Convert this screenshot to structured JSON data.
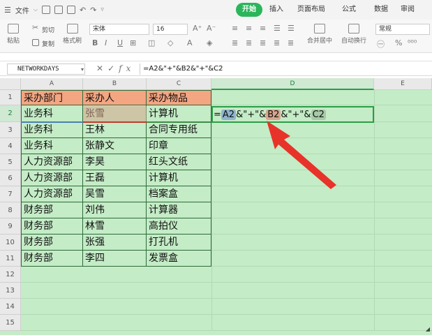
{
  "menu": {
    "file_label": "文件",
    "tabs": [
      {
        "label": "开始",
        "active": true
      },
      {
        "label": "插入",
        "active": false
      },
      {
        "label": "页面布局",
        "active": false
      },
      {
        "label": "公式",
        "active": false
      },
      {
        "label": "数据",
        "active": false
      },
      {
        "label": "审阅",
        "active": false
      }
    ]
  },
  "ribbon": {
    "paste_label": "粘贴",
    "cut_label": "剪切",
    "copy_label": "复制",
    "format_painter_label": "格式刷",
    "font_name": "宋体",
    "font_size": "16",
    "merge_label": "合并居中",
    "wrap_label": "自动换行",
    "number_format": "常规"
  },
  "formula_bar": {
    "name_box": "NETWORKDAYS",
    "formula": "=A2&\"+\"&B2&\"+\"&C2"
  },
  "sheet": {
    "columns": [
      "A",
      "B",
      "C",
      "D",
      "E"
    ],
    "rows": [
      "1",
      "2",
      "3",
      "4",
      "5",
      "6",
      "7",
      "8",
      "9",
      "10",
      "11",
      "12",
      "13",
      "14",
      "15"
    ],
    "headers": [
      "采办部门",
      "采办人",
      "采办物品"
    ],
    "data": [
      [
        "业务科",
        "张雪",
        "计算机"
      ],
      [
        "业务科",
        "王林",
        "合同专用纸"
      ],
      [
        "业务科",
        "张静文",
        "印章"
      ],
      [
        "人力资源部",
        "李昊",
        "红头文纸"
      ],
      [
        "人力资源部",
        "王磊",
        "计算机"
      ],
      [
        "人力资源部",
        "吴雪",
        "档案盒"
      ],
      [
        "财务部",
        "刘伟",
        "计算器"
      ],
      [
        "财务部",
        "林雪",
        "高拍仪"
      ],
      [
        "财务部",
        "张强",
        "打孔机"
      ],
      [
        "财务部",
        "李四",
        "发票盒"
      ]
    ],
    "edit_formula": {
      "eq": "=",
      "ref_a": "A2",
      "part1": "&\"+\"&",
      "ref_b": "B2",
      "part2": "&\"+\"&",
      "ref_c": "C2"
    }
  },
  "colors": {
    "header_fill": "#f4a582",
    "sheet_bg": "#c4ecc6",
    "accent": "#2bb55b",
    "arrow": "#e8332a"
  }
}
